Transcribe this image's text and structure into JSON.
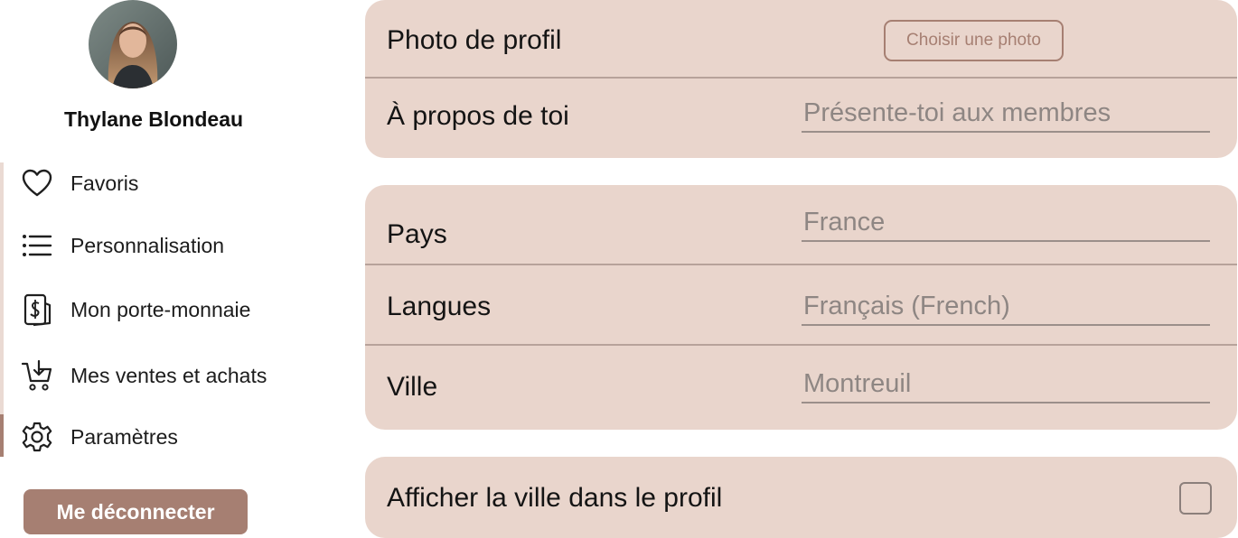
{
  "profile": {
    "name": "Thylane Blondeau"
  },
  "sidebar": {
    "items": [
      {
        "label": "Favoris",
        "icon": "heart-icon"
      },
      {
        "label": "Personnalisation",
        "icon": "list-icon"
      },
      {
        "label": "Mon porte-monnaie",
        "icon": "wallet-icon"
      },
      {
        "label": "Mes ventes et achats",
        "icon": "cart-icon"
      },
      {
        "label": "Paramètres",
        "icon": "gear-icon",
        "active": true
      }
    ],
    "logout_label": "Me déconnecter"
  },
  "main": {
    "photo": {
      "label": "Photo de profil",
      "button_label": "Choisir une photo"
    },
    "about": {
      "label": "À propos de toi",
      "placeholder": "Présente-toi aux membres",
      "value": ""
    },
    "country": {
      "label": "Pays",
      "value": "France"
    },
    "languages": {
      "label": "Langues",
      "value": "Français (French)"
    },
    "city": {
      "label": "Ville",
      "value": "Montreuil"
    },
    "show_city": {
      "label": "Afficher la ville dans le profil",
      "checked": false
    }
  },
  "colors": {
    "accent": "#a67f72",
    "card_bg": "#e9d5cc",
    "divider": "#b7a29a",
    "field_text": "#8e8683"
  }
}
